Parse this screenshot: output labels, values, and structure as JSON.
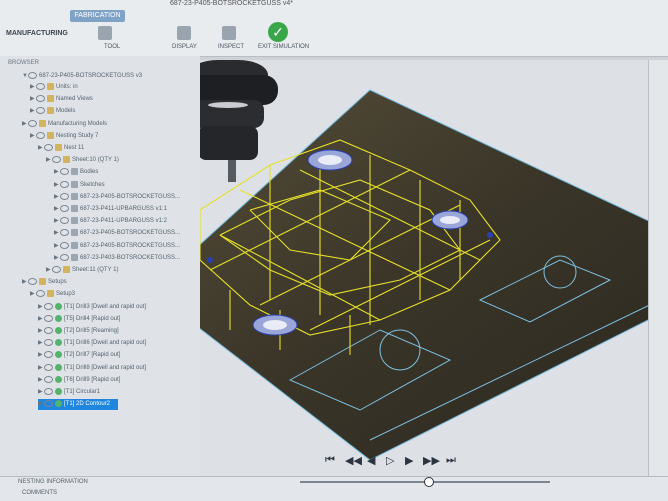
{
  "window": {
    "file_title": "687-23-P405-BOTSROCKETGUSS v4*"
  },
  "toolbar": {
    "workspace": "MANUFACTURING",
    "tabs": [
      "FABRICATION"
    ],
    "groups": [
      "TOOL",
      "DISPLAY",
      "INSPECT",
      "EXIT SIMULATION"
    ],
    "exit_icon": "checkmark-icon"
  },
  "browser": {
    "header": "BROWSER",
    "root": "687-23-P405-BOTSROCKETGUSS v3",
    "items": [
      {
        "label": "Units: in",
        "indent": 2
      },
      {
        "label": "Named Views",
        "indent": 2
      },
      {
        "label": "Models",
        "indent": 2
      },
      {
        "label": "Manufacturing Models",
        "indent": 1
      },
      {
        "label": "Nesting Study 7",
        "indent": 2
      },
      {
        "label": "Nest 11",
        "indent": 3
      },
      {
        "label": "Sheet:10 (QTY 1)",
        "indent": 4
      },
      {
        "label": "Bodies",
        "indent": 5
      },
      {
        "label": "Sketches",
        "indent": 5
      },
      {
        "label": "687-23-P405-BOTSROCKETGUSS...",
        "indent": 5
      },
      {
        "label": "687-23-P411-UPBARGUSS v1:1",
        "indent": 5
      },
      {
        "label": "687-23-P411-UPBARGUSS v1:2",
        "indent": 5
      },
      {
        "label": "687-23-P405-BOTSROCKETGUSS...",
        "indent": 5
      },
      {
        "label": "687-23-P405-BOTSROCKETGUSS...",
        "indent": 5
      },
      {
        "label": "687-23-P403-BOTSROCKETGUSS...",
        "indent": 5
      },
      {
        "label": "Sheet:11 (QTY 1)",
        "indent": 4
      },
      {
        "label": "Setups",
        "indent": 1
      },
      {
        "label": "Setup3",
        "indent": 2
      },
      {
        "label": "[T1] Drill3 [Dwell and rapid out]",
        "indent": 3
      },
      {
        "label": "[T5] Drill4 [Rapid out]",
        "indent": 3
      },
      {
        "label": "[T2] Drill5 [Reaming]",
        "indent": 3
      },
      {
        "label": "[T1] Drill6 [Dwell and rapid out]",
        "indent": 3
      },
      {
        "label": "[T2] Drill7 [Rapid out]",
        "indent": 3
      },
      {
        "label": "[T1] Drill8 [Dwell and rapid out]",
        "indent": 3
      },
      {
        "label": "[T6] Drill9 [Rapid out]",
        "indent": 3
      },
      {
        "label": "[T1] Circular1",
        "indent": 3
      },
      {
        "label": "[T1] 2D Contour2",
        "indent": 3,
        "selected": true
      }
    ]
  },
  "bottom": {
    "nesting_information": "NESTING INFORMATION",
    "comments": "COMMENTS"
  },
  "colors": {
    "toolpath": "#e5e02a",
    "selection": "#1f86e0",
    "sheet": "#3f3a2d",
    "contour": "#6fb5d8"
  }
}
